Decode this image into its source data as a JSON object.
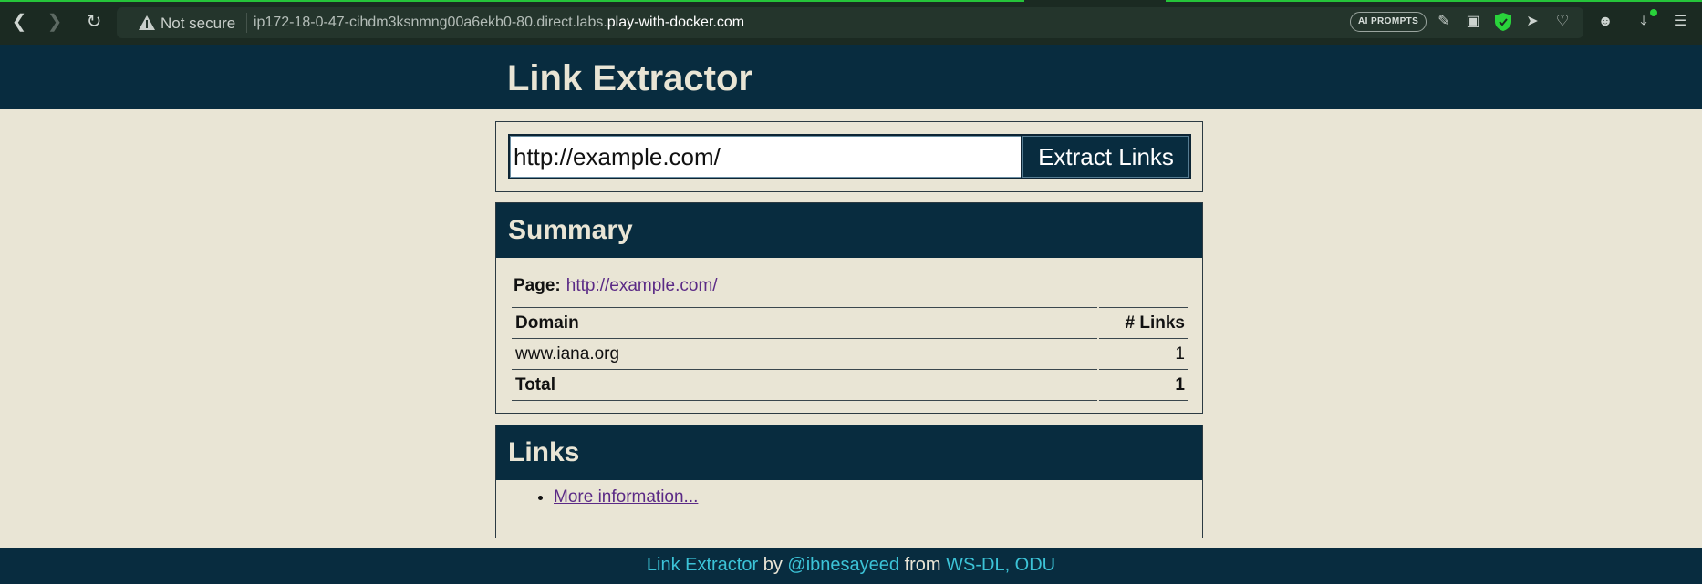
{
  "browser": {
    "security_label": "Not secure",
    "url_prefix": "ip172-18-0-47-cihdm3ksnmng00a6ekb0-80.direct.labs.",
    "url_host": "play-with-docker.com",
    "ai_prompts_label": "AI PROMPTS",
    "accent_color": "#25c43a"
  },
  "header": {
    "title": "Link Extractor"
  },
  "form": {
    "url_value": "http://example.com/",
    "submit_label": "Extract Links"
  },
  "summary": {
    "heading": "Summary",
    "page_label": "Page:",
    "page_url": "http://example.com/",
    "columns": [
      "Domain",
      "# Links"
    ],
    "rows": [
      {
        "domain": "www.iana.org",
        "count": "1"
      }
    ],
    "total_label": "Total",
    "total_count": "1"
  },
  "links": {
    "heading": "Links",
    "items": [
      {
        "label": "More information..."
      }
    ]
  },
  "footer": {
    "app_name": "Link Extractor",
    "by": "by",
    "author": "@ibnesayeed",
    "from": "from",
    "org": "WS-DL, ODU"
  },
  "colors": {
    "header_bg": "#082c3f",
    "page_bg": "#e9e5d5",
    "link": "#5b2a86",
    "footer_link": "#3cc3d7"
  }
}
